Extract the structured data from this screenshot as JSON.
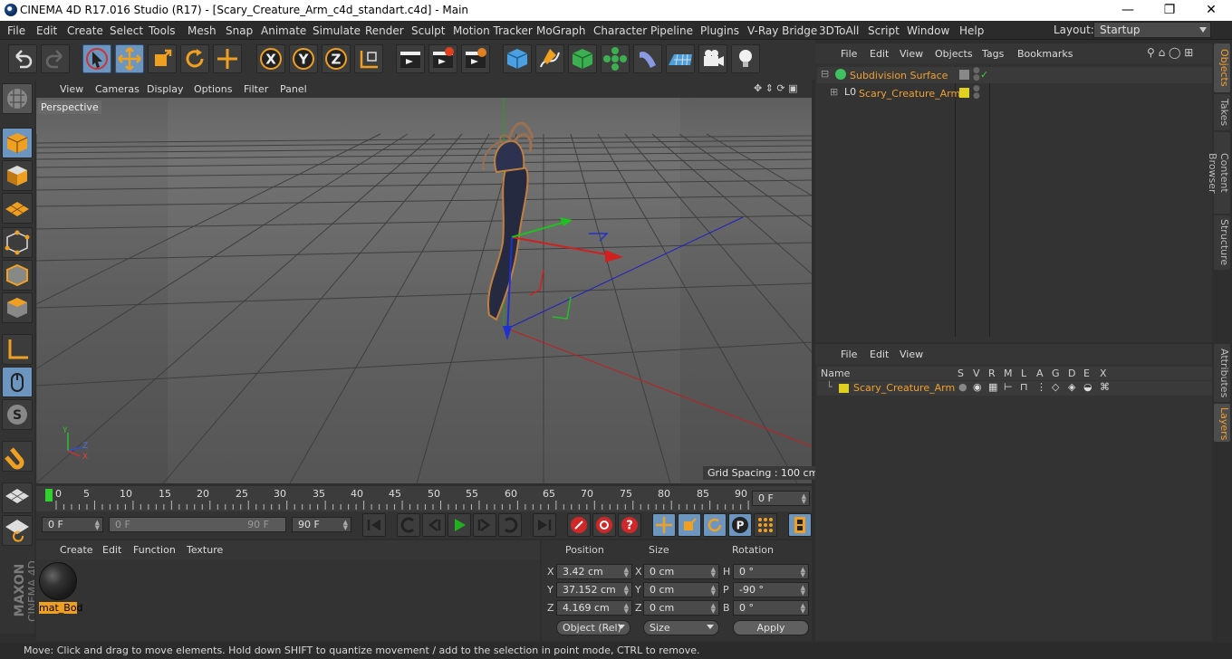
{
  "title_bar": {
    "title": "CINEMA 4D R17.016 Studio (R17) - [Scary_Creature_Arm_c4d_standart.c4d] - Main",
    "minimize": "—",
    "maximize": "❐",
    "close": "✕"
  },
  "menu": [
    "File",
    "Edit",
    "Create",
    "Select",
    "Tools",
    "Mesh",
    "Snap",
    "Animate",
    "Simulate",
    "Render",
    "Sculpt",
    "Motion Tracker",
    "MoGraph",
    "Character",
    "Pipeline",
    "Plugins",
    "V-Ray Bridge",
    "3DToAll",
    "Script",
    "Window",
    "Help"
  ],
  "layout": {
    "label": "Layout:",
    "value": "Startup"
  },
  "viewport": {
    "menu": [
      "View",
      "Cameras",
      "Display",
      "Options",
      "Filter",
      "Panel"
    ],
    "camera_label": "Perspective",
    "grid_spacing": "Grid Spacing : 100 cm",
    "axis_x": "X",
    "axis_y": "Y",
    "axis_z": "Z"
  },
  "timeline": {
    "ticks": [
      "0",
      "5",
      "10",
      "15",
      "20",
      "25",
      "30",
      "35",
      "40",
      "45",
      "50",
      "55",
      "60",
      "65",
      "70",
      "75",
      "80",
      "85",
      "90"
    ],
    "current_frame": "0 F"
  },
  "animation": {
    "start": "0 F",
    "range_start": "0 F",
    "range_end": "90 F",
    "end": "90 F"
  },
  "material_panel": {
    "menu": [
      "Create",
      "Edit",
      "Function",
      "Texture"
    ],
    "material_name": "mat_Bod"
  },
  "attributes": {
    "headers": {
      "position": "Position",
      "size": "Size",
      "rotation": "Rotation"
    },
    "rows": [
      {
        "axis": "X",
        "pos": "3.42 cm",
        "saxis": "X",
        "size": "0 cm",
        "raxis": "H",
        "rot": "0 °"
      },
      {
        "axis": "Y",
        "pos": "37.152 cm",
        "saxis": "Y",
        "size": "0 cm",
        "raxis": "P",
        "rot": "-90 °"
      },
      {
        "axis": "Z",
        "pos": "4.169 cm",
        "saxis": "Z",
        "size": "0 cm",
        "raxis": "B",
        "rot": "0 °"
      }
    ],
    "mode": "Object (Rel)",
    "size_mode": "Size",
    "apply": "Apply"
  },
  "objects_panel": {
    "menu": [
      "File",
      "Edit",
      "View",
      "Objects",
      "Tags",
      "Bookmarks"
    ],
    "items": [
      {
        "name": "Subdivision Surface"
      },
      {
        "name": "Scary_Creature_Arm"
      }
    ]
  },
  "layers_panel": {
    "menu": [
      "File",
      "Edit",
      "View"
    ],
    "columns": [
      "Name",
      "S",
      "V",
      "R",
      "M",
      "L",
      "A",
      "G",
      "D",
      "E",
      "X"
    ],
    "layer_name": "Scary_Creature_Arm"
  },
  "right_tabs": [
    "Objects",
    "Takes",
    "Content Browser",
    "Structure",
    "Attributes",
    "Layers"
  ],
  "side_logo": {
    "line1": "MAXON",
    "line2": "CINEMA 4D"
  },
  "status": "Move: Click and drag to move elements. Hold down SHIFT to quantize movement / add to the selection in point mode, CTRL to remove.",
  "colors": {
    "accent": "#f0a030",
    "active_tool": "#6c95c0",
    "layer_yellow": "#e0d020"
  }
}
